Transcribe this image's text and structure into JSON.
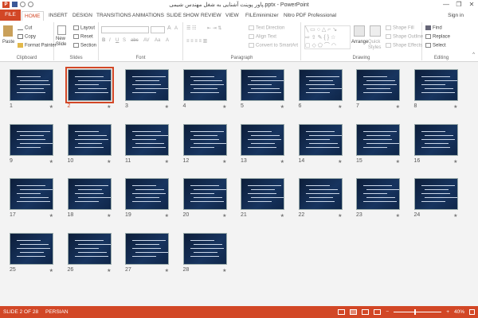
{
  "window": {
    "title": "پاور پوینت آشنایی به شغل مهندس شیمی.pptx - PowerPoint",
    "minimize": "—",
    "restore": "❐",
    "close": "✕"
  },
  "tabs": {
    "file": "FILE",
    "home": "HOME",
    "insert": "INSERT",
    "design": "DESIGN",
    "transitions": "TRANSITIONS",
    "animations": "ANIMATIONS",
    "slideshow": "SLIDE SHOW",
    "review": "REVIEW",
    "view": "VIEW",
    "filemin": "FILEminimizer",
    "nitro": "Nitro PDF Professional",
    "signin": "Sign in"
  },
  "ribbon": {
    "clipboard": {
      "paste": "Paste",
      "cut": "Cut",
      "copy": "Copy",
      "format_painter": "Format Painter",
      "label": "Clipboard"
    },
    "slides": {
      "new_slide": "New Slide",
      "layout": "Layout",
      "reset": "Reset",
      "section": "Section",
      "label": "Slides"
    },
    "font": {
      "label": "Font"
    },
    "paragraph": {
      "text_direction": "Text Direction",
      "align_text": "Align Text",
      "convert": "Convert to SmartArt",
      "label": "Paragraph"
    },
    "drawing": {
      "arrange": "Arrange",
      "quick_styles": "Quick Styles",
      "shape_fill": "Shape Fill",
      "shape_outline": "Shape Outline",
      "shape_effects": "Shape Effects",
      "label": "Drawing"
    },
    "editing": {
      "find": "Find",
      "replace": "Replace",
      "select": "Select",
      "label": "Editing"
    }
  },
  "slides": [
    {
      "n": "1"
    },
    {
      "n": "2"
    },
    {
      "n": "3"
    },
    {
      "n": "4"
    },
    {
      "n": "5"
    },
    {
      "n": "6"
    },
    {
      "n": "7"
    },
    {
      "n": "8"
    },
    {
      "n": "9"
    },
    {
      "n": "10"
    },
    {
      "n": "11"
    },
    {
      "n": "12"
    },
    {
      "n": "13"
    },
    {
      "n": "14"
    },
    {
      "n": "15"
    },
    {
      "n": "16"
    },
    {
      "n": "17"
    },
    {
      "n": "18"
    },
    {
      "n": "19"
    },
    {
      "n": "20"
    },
    {
      "n": "21"
    },
    {
      "n": "22"
    },
    {
      "n": "23"
    },
    {
      "n": "24"
    },
    {
      "n": "25"
    },
    {
      "n": "26"
    },
    {
      "n": "27"
    },
    {
      "n": "28"
    }
  ],
  "star": "★",
  "status": {
    "slide_info": "SLIDE 2 OF 28",
    "language": "PERSIAN",
    "zoom": "40%"
  },
  "colors": {
    "accent": "#d24726",
    "slide_bg": "#17345f"
  }
}
